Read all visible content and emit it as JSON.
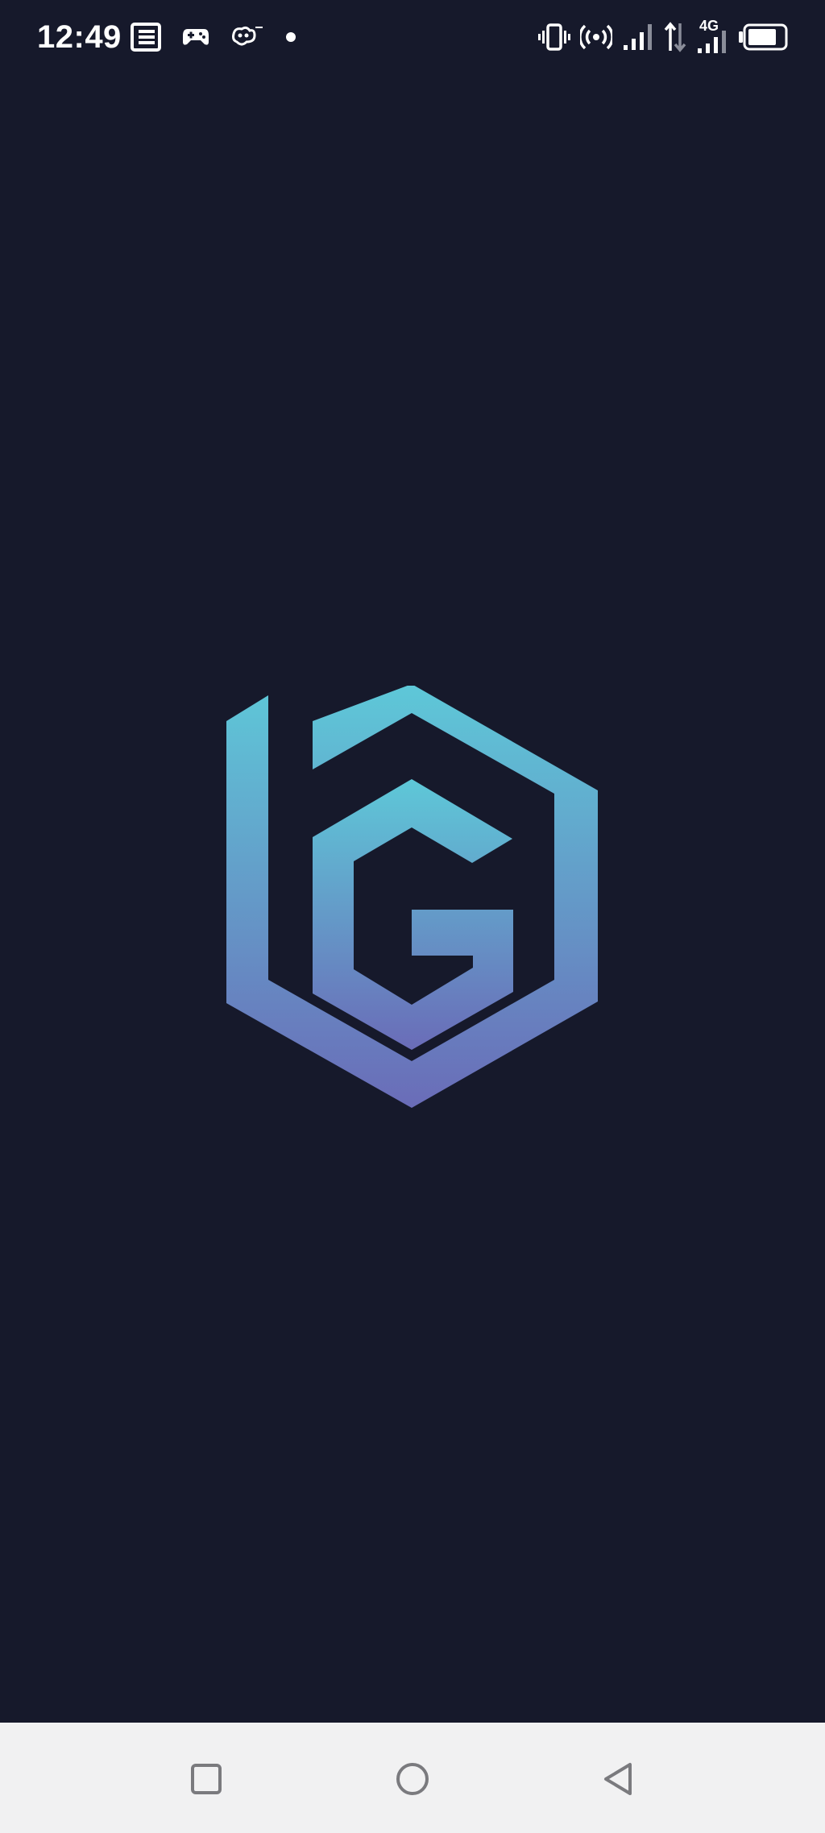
{
  "status_bar": {
    "time": "12:49",
    "network_label": "4G",
    "left_icons": [
      "news-icon",
      "gamepad-icon",
      "carrier-app-icon",
      "notification-dot-icon"
    ],
    "right_icons": [
      "vibrate-icon",
      "hotspot-icon",
      "signal-icon",
      "data-arrows-icon",
      "signal-4g-icon",
      "battery-icon"
    ],
    "battery_level": 0.8
  },
  "splash": {
    "logo_icon": "bg-hexagon-logo",
    "gradient_top": "#5ec8d8",
    "gradient_bottom": "#6a6cb8"
  },
  "nav_bar": {
    "buttons": [
      "recents-icon",
      "home-icon",
      "back-icon"
    ]
  },
  "colors": {
    "background": "#16192b",
    "nav_background": "#f1f1f2",
    "nav_icon": "#7a7a7e"
  }
}
